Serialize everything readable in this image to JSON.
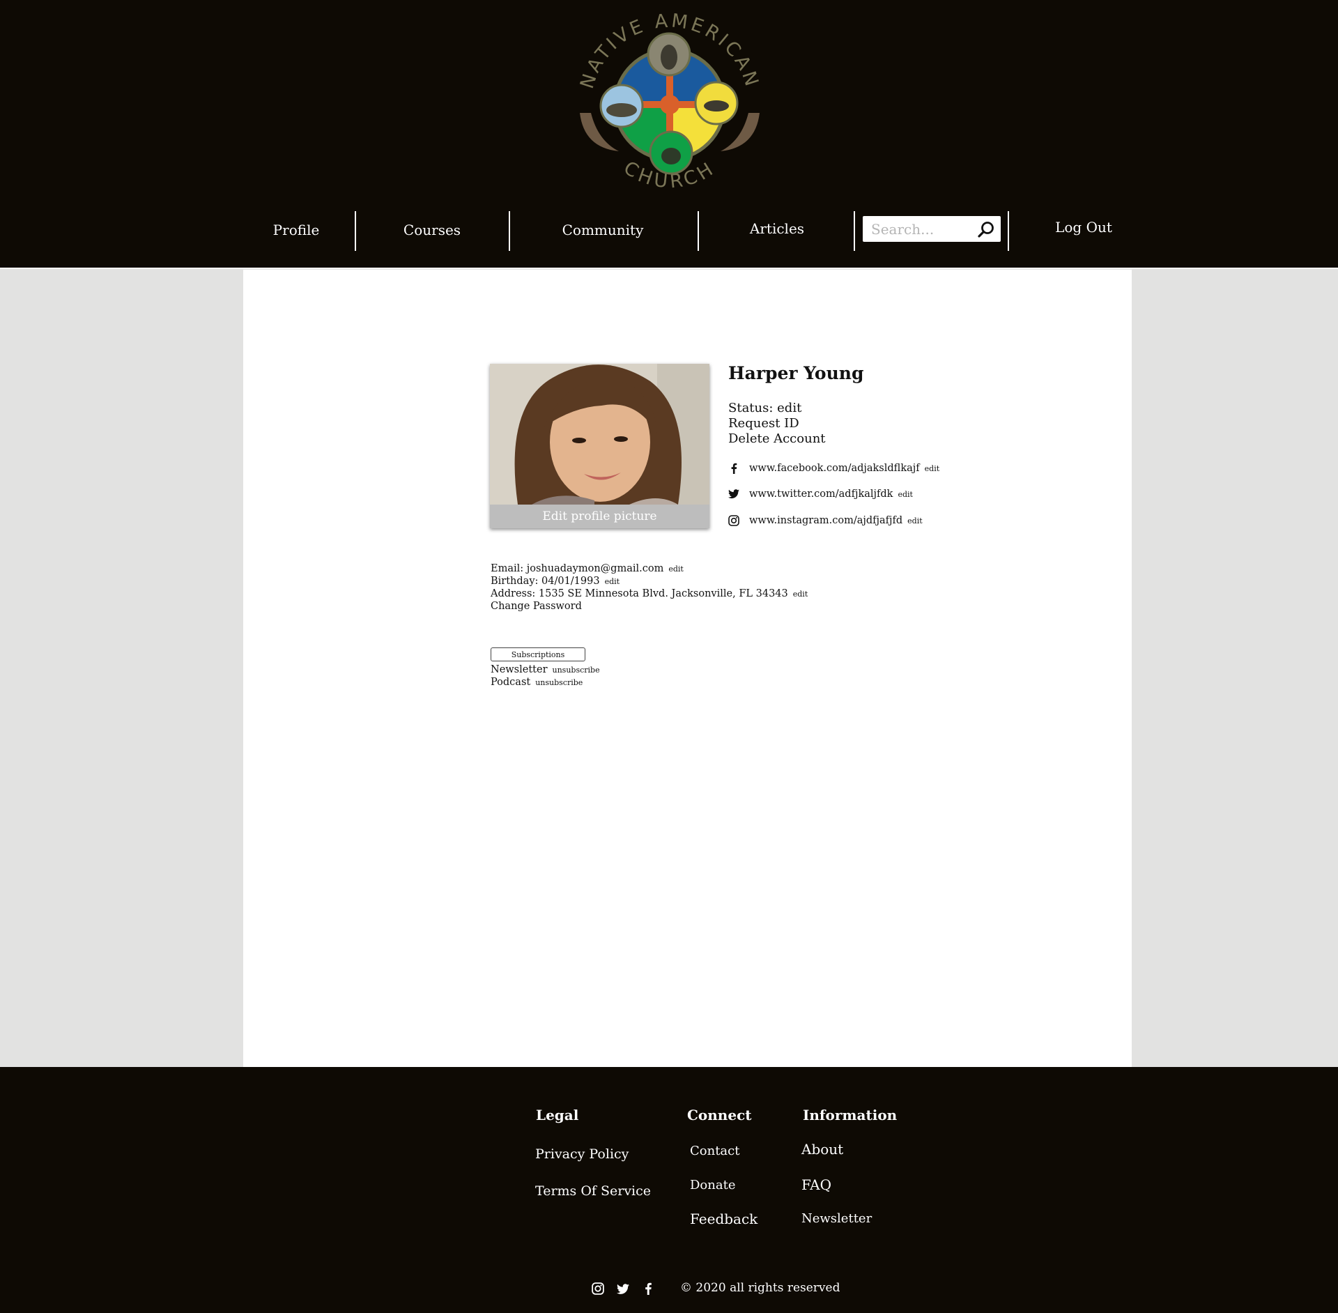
{
  "header": {
    "logo": {
      "text_top": "NATIVE AMERICAN",
      "text_bottom": "CHURCH",
      "colors": {
        "blue": "#1a5a9e",
        "yellow": "#f4e03a",
        "green": "#0fa046",
        "orange": "#d9602a",
        "ring": "#6b6d4a",
        "text": "#7b7657"
      }
    },
    "nav": {
      "profile": "Profile",
      "courses": "Courses",
      "community": "Community",
      "articles": "Articles",
      "logout": "Log Out"
    },
    "search": {
      "placeholder": "Search..."
    }
  },
  "profile": {
    "edit_picture_label": "Edit profile picture",
    "name": "Harper Young",
    "status": "Status: edit",
    "request_id": "Request ID",
    "delete_account": "Delete Account",
    "social": [
      {
        "icon": "facebook-icon",
        "url": "www.facebook.com/adjaksldflkajf",
        "edit": "edit"
      },
      {
        "icon": "twitter-icon",
        "url": "www.twitter.com/adfjkaljfdk",
        "edit": "edit"
      },
      {
        "icon": "instagram-icon",
        "url": "www.instagram.com/ajdfjafjfd",
        "edit": "edit"
      }
    ]
  },
  "details": {
    "email": "Email: joshuadaymon@gmail.com",
    "email_edit": "edit",
    "birthday": "Birthday: 04/01/1993",
    "birthday_edit": "edit",
    "address": "Address: 1535 SE Minnesota Blvd. Jacksonville, FL 34343",
    "address_edit": "edit",
    "change_password": "Change Password"
  },
  "subscriptions": {
    "button_label": "Subscriptions",
    "items": [
      {
        "name": "Newsletter",
        "action": "unsubscribe"
      },
      {
        "name": "Podcast",
        "action": "unsubscribe"
      }
    ]
  },
  "footer": {
    "legal": {
      "title": "Legal",
      "links": [
        "Privacy Policy",
        "Terms Of Service"
      ]
    },
    "connect": {
      "title": "Connect",
      "links": [
        "Contact",
        "Donate",
        "Feedback"
      ]
    },
    "information": {
      "title": "Information",
      "links": [
        "About",
        "FAQ",
        "Newsletter"
      ]
    },
    "social_icons": [
      "instagram-icon",
      "twitter-icon",
      "facebook-icon"
    ],
    "copyright": "© 2020 all rights reserved"
  }
}
